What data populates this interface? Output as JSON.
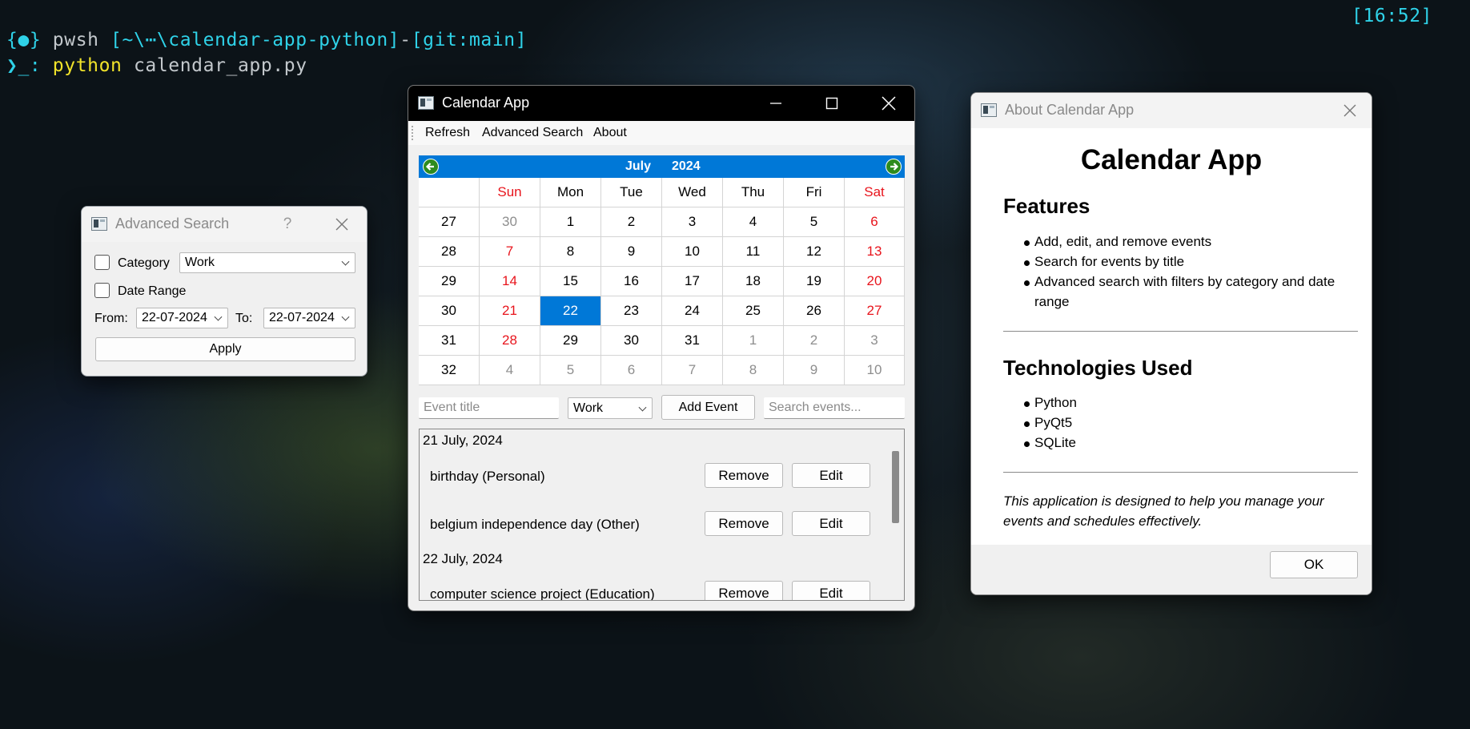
{
  "terminal": {
    "line1": {
      "prompt_icon": "{●}",
      "shell": "pwsh",
      "path": "[~\\⋯\\calendar-app-python]",
      "dash": "-",
      "git": "[git:",
      "branch": "main]",
      "time": "[16:52]"
    },
    "line2": {
      "prompt": "❯_:",
      "command": "python",
      "args": "calendar_app.py"
    }
  },
  "advanced_search": {
    "title": "Advanced Search",
    "help": "?",
    "category_label": "Category",
    "category_value": "Work",
    "category_checked": false,
    "date_range_label": "Date Range",
    "date_range_checked": false,
    "from_label": "From:",
    "from_value": "22-07-2024",
    "to_label": "To:",
    "to_value": "22-07-2024",
    "apply_label": "Apply"
  },
  "calendar_app": {
    "title": "Calendar App",
    "menu": [
      "Refresh",
      "Advanced Search",
      "About"
    ],
    "month": "July",
    "year": "2024",
    "weekdays": [
      "Sun",
      "Mon",
      "Tue",
      "Wed",
      "Thu",
      "Fri",
      "Sat"
    ],
    "weeks": [
      {
        "num": "27",
        "days": [
          "30",
          "1",
          "2",
          "3",
          "4",
          "5",
          "6"
        ]
      },
      {
        "num": "28",
        "days": [
          "7",
          "8",
          "9",
          "10",
          "11",
          "12",
          "13"
        ]
      },
      {
        "num": "29",
        "days": [
          "14",
          "15",
          "16",
          "17",
          "18",
          "19",
          "20"
        ]
      },
      {
        "num": "30",
        "days": [
          "21",
          "22",
          "23",
          "24",
          "25",
          "26",
          "27"
        ]
      },
      {
        "num": "31",
        "days": [
          "28",
          "29",
          "30",
          "31",
          "1",
          "2",
          "3"
        ]
      },
      {
        "num": "32",
        "days": [
          "4",
          "5",
          "6",
          "7",
          "8",
          "9",
          "10"
        ]
      }
    ],
    "selected_day": "22",
    "event_title_placeholder": "Event title",
    "category_value": "Work",
    "add_event_label": "Add Event",
    "search_placeholder": "Search events...",
    "event_groups": [
      {
        "date": "21 July, 2024",
        "events": [
          {
            "text": "birthday (Personal)",
            "remove": "Remove",
            "edit": "Edit"
          },
          {
            "text": "belgium independence day (Other)",
            "remove": "Remove",
            "edit": "Edit"
          }
        ]
      },
      {
        "date": "22 July, 2024",
        "events": [
          {
            "text": "computer science project (Education)",
            "remove": "Remove",
            "edit": "Edit"
          }
        ]
      }
    ]
  },
  "about": {
    "title": "About Calendar App",
    "heading": "Calendar App",
    "features_heading": "Features",
    "features": [
      "Add, edit, and remove events",
      "Search for events by title",
      "Advanced search with filters by category and date",
      "range"
    ],
    "tech_heading": "Technologies Used",
    "technologies": [
      "Python",
      "PyQt5",
      "SQLite"
    ],
    "footer_line1": "This application is designed to help you manage your",
    "footer_line2": "events and schedules effectively.",
    "ok_label": "OK"
  },
  "colors": {
    "accent": "#0078d7",
    "weekend": "#e8141c",
    "terminal_cyan": "#2fd2e8",
    "terminal_yellow": "#f1e32a"
  }
}
